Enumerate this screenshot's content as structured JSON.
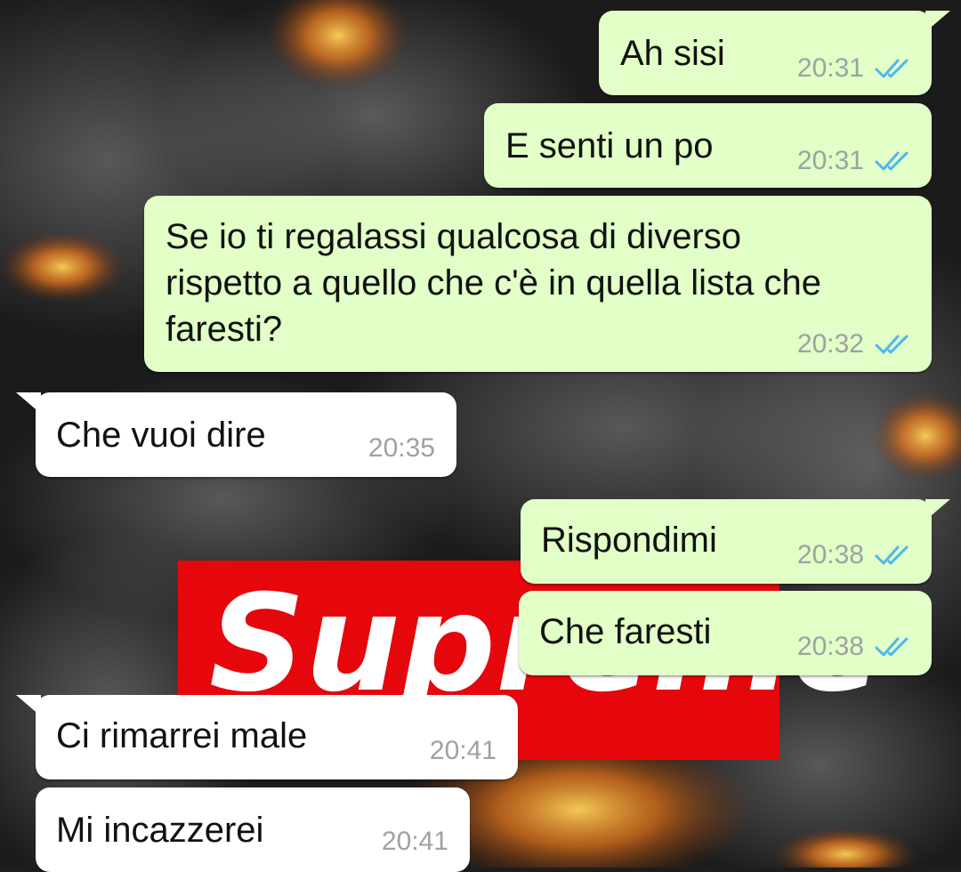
{
  "colors": {
    "outgoing_bubble": "#e1ffc7",
    "incoming_bubble": "#ffffff",
    "read_ticks": "#4fb6ec",
    "timestamp": "#9ca3a0",
    "wallpaper_logo_red": "#e5070c"
  },
  "wallpaper": {
    "logo_text": "Supreme"
  },
  "messages": [
    {
      "direction": "outgoing",
      "text": "Ah sisi",
      "time": "20:31",
      "status": "read-double-check-icon"
    },
    {
      "direction": "outgoing",
      "text": "E senti un po",
      "time": "20:31",
      "status": "read-double-check-icon"
    },
    {
      "direction": "outgoing",
      "lines": [
        "Se io ti regalassi qualcosa di diverso",
        "rispetto a quello che c'è in quella lista che",
        "faresti?"
      ],
      "time": "20:32",
      "status": "read-double-check-icon"
    },
    {
      "direction": "incoming",
      "text": "Che vuoi dire",
      "time": "20:35"
    },
    {
      "direction": "outgoing",
      "text": "Rispondimi",
      "time": "20:38",
      "status": "read-double-check-icon"
    },
    {
      "direction": "outgoing",
      "text": "Che faresti",
      "time": "20:38",
      "status": "read-double-check-icon"
    },
    {
      "direction": "incoming",
      "text": "Ci rimarrei male",
      "time": "20:41"
    },
    {
      "direction": "incoming",
      "text": "Mi incazzerei",
      "time": "20:41"
    }
  ]
}
